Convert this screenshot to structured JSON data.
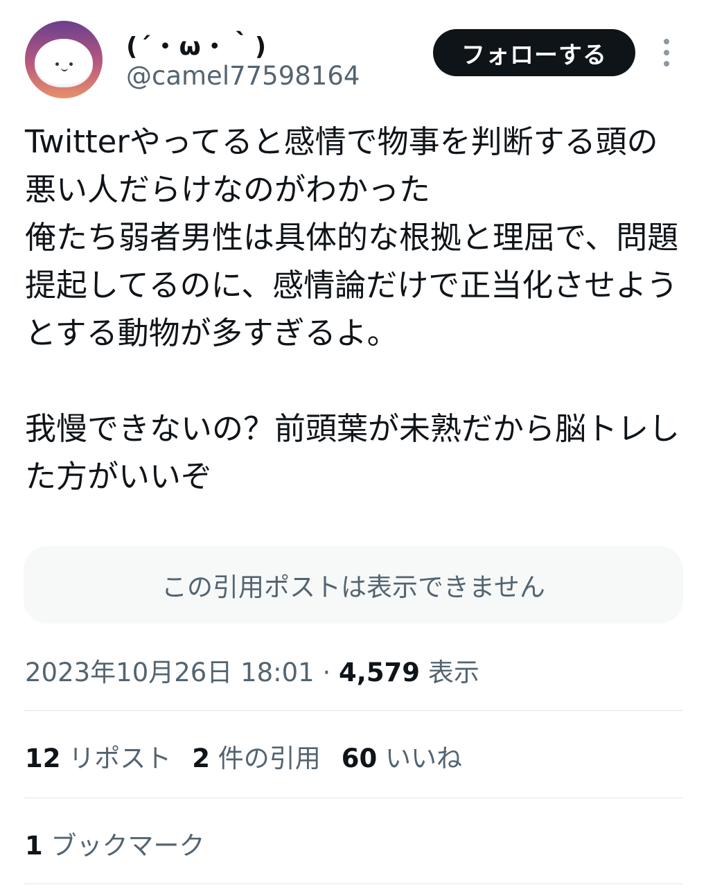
{
  "author": {
    "display_name": "(´・ω・｀)",
    "handle": "@camel77598164",
    "avatar_icon": "avatar-mochi-icon"
  },
  "actions": {
    "follow_label": "フォローする",
    "more_icon": "more-vertical-icon"
  },
  "tweet": {
    "text": "Twitterやってると感情で物事を判断する頭の悪い人だらけなのがわかった\n俺たち弱者男性は具体的な根拠と理屈で、問題提起してるのに、感情論だけで正当化させようとする動物が多すぎるよ。\n\n我慢できないの？前頭葉が未熟だから脳トレした方がいいぞ",
    "quote_unavailable": "この引用ポストは表示できません"
  },
  "meta": {
    "timestamp": "2023年10月26日 18:01",
    "separator": " · ",
    "views_count": "4,579",
    "views_label": "表示"
  },
  "stats": {
    "reposts_count": "12",
    "reposts_label": "リポスト",
    "quotes_count": "2",
    "quotes_label": "件の引用",
    "likes_count": "60",
    "likes_label": "いいね",
    "bookmarks_count": "1",
    "bookmarks_label": "ブックマーク"
  },
  "colors": {
    "text_primary": "#0f1419",
    "text_secondary": "#536471",
    "follow_button_bg": "#0f1419",
    "quote_box_bg": "#f7f9f9",
    "divider": "#e1e6ea"
  }
}
